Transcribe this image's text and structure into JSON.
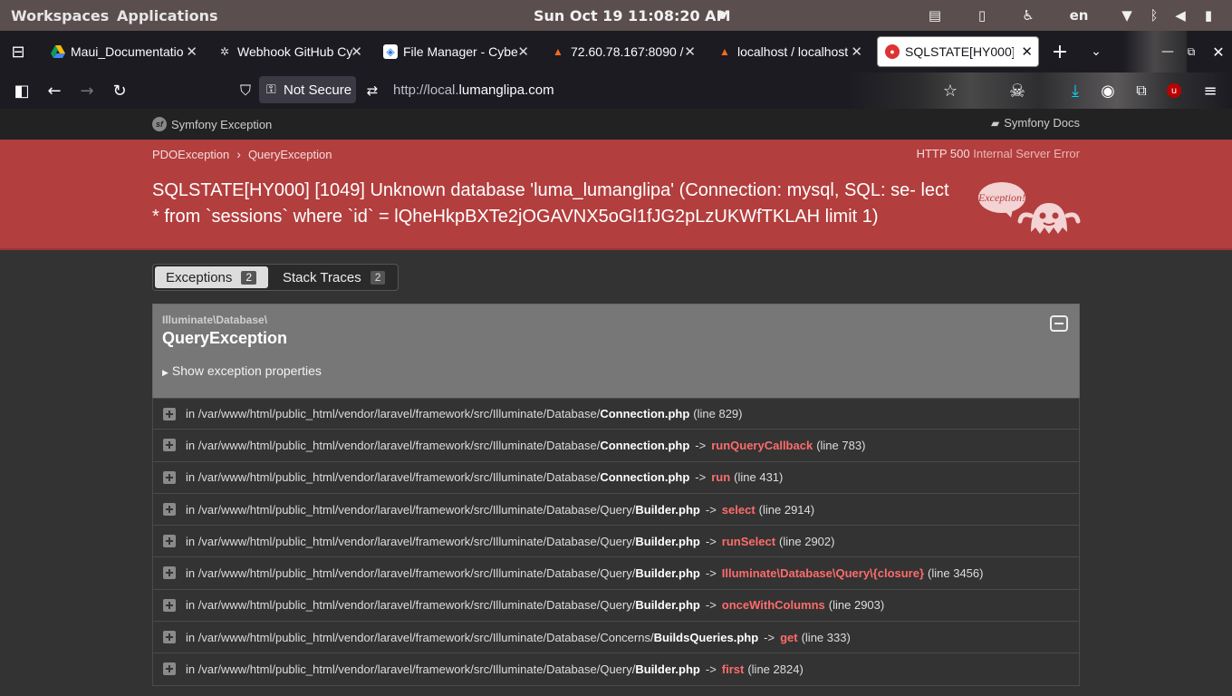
{
  "topbar": {
    "workspaces": "Workspaces",
    "applications": "Applications",
    "clock": "Sun Oct 19  11:08:20 AM",
    "lang": "en"
  },
  "tabs": [
    {
      "title": "Maui_Documentatio",
      "icon": "google-drive-icon"
    },
    {
      "title": "Webhook GitHub Cy",
      "icon": "github-icon"
    },
    {
      "title": "File Manager - Cybe",
      "icon": "cyberpanel-icon"
    },
    {
      "title": "72.60.78.167:8090 /",
      "icon": "cyberpanel-icon"
    },
    {
      "title": "localhost / localhost",
      "icon": "phpmyadmin-icon"
    },
    {
      "title": "SQLSTATE[HY000]",
      "icon": "symfony-ghost-icon"
    }
  ],
  "navbar": {
    "security_label": "Not Secure",
    "url_prefix": "http://local.",
    "url_domain": "lumanglipa.com"
  },
  "symfony": {
    "brand": "Symfony Exception",
    "docs": "Symfony Docs",
    "breadcrumb": [
      "PDOException",
      "QueryException"
    ],
    "http_code": "HTTP 500",
    "http_text": "Internal Server Error",
    "message": "SQLSTATE[HY000] [1049] Unknown database 'luma_lumanglipa' (Connection: mysql, SQL: se- lect * from `sessions` where `id` = lQheHkpBXTe2jOGAVNX5oGl1fJG2pLzUKWfTKLAH limit 1)",
    "ghost_label": "Exception!",
    "tab_exceptions": "Exceptions",
    "tab_exceptions_count": "2",
    "tab_traces": "Stack Traces",
    "tab_traces_count": "2",
    "exception_namespace": "Illuminate\\Database\\",
    "exception_class": "QueryException",
    "show_props": "Show exception properties"
  },
  "trace": [
    {
      "path": "in /var/www/html/public_html/vendor/laravel/framework/src/Illuminate/Database/",
      "file": "Connection.php",
      "fn": "",
      "line": "(line 829)"
    },
    {
      "path": "in /var/www/html/public_html/vendor/laravel/framework/src/Illuminate/Database/",
      "file": "Connection.php",
      "fn": "runQueryCallback",
      "line": "(line 783)"
    },
    {
      "path": "in /var/www/html/public_html/vendor/laravel/framework/src/Illuminate/Database/",
      "file": "Connection.php",
      "fn": "run",
      "line": "(line 431)"
    },
    {
      "path": "in /var/www/html/public_html/vendor/laravel/framework/src/Illuminate/Database/Query/",
      "file": "Builder.php",
      "fn": "select",
      "line": "(line 2914)"
    },
    {
      "path": "in /var/www/html/public_html/vendor/laravel/framework/src/Illuminate/Database/Query/",
      "file": "Builder.php",
      "fn": "runSelect",
      "line": "(line 2902)"
    },
    {
      "path": "in /var/www/html/public_html/vendor/laravel/framework/src/Illuminate/Database/Query/",
      "file": "Builder.php",
      "fn": "Illuminate\\Database\\Query\\{closure}",
      "line": "(line 3456)"
    },
    {
      "path": "in /var/www/html/public_html/vendor/laravel/framework/src/Illuminate/Database/Query/",
      "file": "Builder.php",
      "fn": "onceWithColumns",
      "line": "(line 2903)"
    },
    {
      "path": "in /var/www/html/public_html/vendor/laravel/framework/src/Illuminate/Database/Concerns/",
      "file": "BuildsQueries.php",
      "fn": "get",
      "line": "(line 333)"
    },
    {
      "path": "in /var/www/html/public_html/vendor/laravel/framework/src/Illuminate/Database/Query/",
      "file": "Builder.php",
      "fn": "first",
      "line": "(line 2824)"
    }
  ]
}
